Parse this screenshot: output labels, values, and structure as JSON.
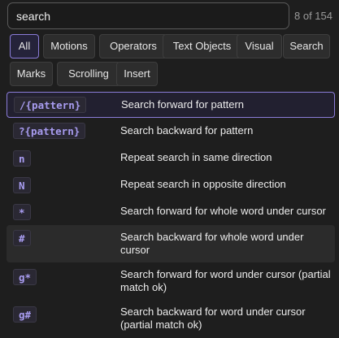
{
  "search": {
    "value": "search",
    "count": "8 of 154"
  },
  "filters": [
    {
      "label": "All",
      "active": true
    },
    {
      "label": "Motions",
      "active": false
    },
    {
      "label": "Operators",
      "active": false
    },
    {
      "label": "Text Objects",
      "active": false
    },
    {
      "label": "Visual",
      "active": false
    },
    {
      "label": "Search",
      "active": false
    },
    {
      "label": "Marks",
      "active": false
    },
    {
      "label": "Scrolling",
      "active": false
    },
    {
      "label": "Insert",
      "active": false
    }
  ],
  "results": [
    {
      "key": "/{pattern}",
      "desc": "Search forward for pattern",
      "state": "selected"
    },
    {
      "key": "?{pattern}",
      "desc": "Search backward for pattern",
      "state": ""
    },
    {
      "key": "n",
      "desc": "Repeat search in same direction",
      "state": ""
    },
    {
      "key": "N",
      "desc": "Repeat search in opposite direction",
      "state": ""
    },
    {
      "key": "*",
      "desc": "Search forward for whole word under cursor",
      "state": ""
    },
    {
      "key": "#",
      "desc": "Search backward for whole word under cursor",
      "state": "hovered"
    },
    {
      "key": "g*",
      "desc": "Search forward for word under cursor (partial match ok)",
      "state": ""
    },
    {
      "key": "g#",
      "desc": "Search backward for word under cursor (partial match ok)",
      "state": ""
    }
  ]
}
